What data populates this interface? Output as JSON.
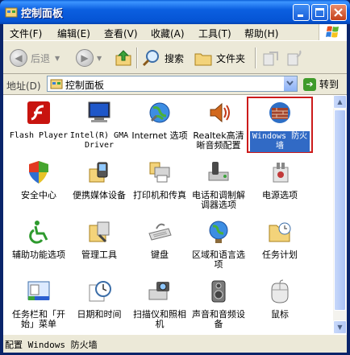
{
  "window": {
    "title": "控制面板"
  },
  "menu": [
    "文件(F)",
    "编辑(E)",
    "查看(V)",
    "收藏(A)",
    "工具(T)",
    "帮助(H)"
  ],
  "toolbar": {
    "back": "后退",
    "search": "搜索",
    "folders": "文件夹"
  },
  "address": {
    "label": "地址(D)",
    "value": "控制面板",
    "go": "转到"
  },
  "items": [
    {
      "id": "flash",
      "label": "Flash Player"
    },
    {
      "id": "intel",
      "label": "Intel(R) GMA Driver"
    },
    {
      "id": "internet",
      "label": "Internet 选项"
    },
    {
      "id": "realtek",
      "label": "Realtek高清晰音频配置"
    },
    {
      "id": "firewall",
      "label": "Windows 防火墙",
      "selected": true
    },
    {
      "id": "security",
      "label": "安全中心"
    },
    {
      "id": "portable",
      "label": "便携媒体设备"
    },
    {
      "id": "printers",
      "label": "打印机和传真"
    },
    {
      "id": "phone",
      "label": "电话和调制解调器选项"
    },
    {
      "id": "power",
      "label": "电源选项"
    },
    {
      "id": "accessibility",
      "label": "辅助功能选项"
    },
    {
      "id": "admin",
      "label": "管理工具"
    },
    {
      "id": "keyboard",
      "label": "键盘"
    },
    {
      "id": "region",
      "label": "区域和语言选项"
    },
    {
      "id": "tasks",
      "label": "任务计划"
    },
    {
      "id": "taskbar",
      "label": "任务栏和「开始」菜单"
    },
    {
      "id": "datetime",
      "label": "日期和时间"
    },
    {
      "id": "scanners",
      "label": "扫描仪和照相机"
    },
    {
      "id": "sound",
      "label": "声音和音频设备"
    },
    {
      "id": "mouse",
      "label": "鼠标"
    }
  ],
  "status": "配置 Windows 防火墙"
}
